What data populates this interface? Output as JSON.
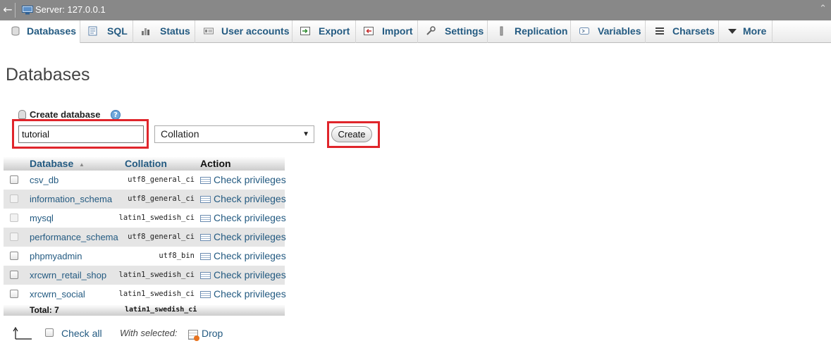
{
  "serverbar": {
    "label": "Server: 127.0.0.1",
    "back_glyph": "←",
    "collapse_glyph": "⌃"
  },
  "tabs": [
    {
      "label": "Databases",
      "icon": "database-icon",
      "active": true
    },
    {
      "label": "SQL",
      "icon": "sql-icon"
    },
    {
      "label": "Status",
      "icon": "status-icon"
    },
    {
      "label": "User accounts",
      "icon": "user-accounts-icon"
    },
    {
      "label": "Export",
      "icon": "export-icon"
    },
    {
      "label": "Import",
      "icon": "import-icon"
    },
    {
      "label": "Settings",
      "icon": "wrench-icon"
    },
    {
      "label": "Replication",
      "icon": "replication-icon"
    },
    {
      "label": "Variables",
      "icon": "variables-icon"
    },
    {
      "label": "Charsets",
      "icon": "charsets-icon"
    },
    {
      "label": "More",
      "icon": "caret-down-icon"
    }
  ],
  "page_title": "Databases",
  "create": {
    "heading": "Create database",
    "help_glyph": "?",
    "name_value": "tutorial",
    "collation_selected": "Collation",
    "collation_caret": "▼",
    "button_label": "Create",
    "highlight_color": "#e0252b"
  },
  "table": {
    "headers": {
      "database": "Database",
      "sort_glyph": "▲",
      "collation": "Collation",
      "action": "Action"
    },
    "rows": [
      {
        "name": "csv_db",
        "collation": "utf8_general_ci",
        "action": "Check privileges",
        "system": false
      },
      {
        "name": "information_schema",
        "collation": "utf8_general_ci",
        "action": "Check privileges",
        "system": true
      },
      {
        "name": "mysql",
        "collation": "latin1_swedish_ci",
        "action": "Check privileges",
        "system": true
      },
      {
        "name": "performance_schema",
        "collation": "utf8_general_ci",
        "action": "Check privileges",
        "system": true
      },
      {
        "name": "phpmyadmin",
        "collation": "utf8_bin",
        "action": "Check privileges",
        "system": false
      },
      {
        "name": "xrcwrn_retail_shop",
        "collation": "latin1_swedish_ci",
        "action": "Check privileges",
        "system": false
      },
      {
        "name": "xrcwrn_social",
        "collation": "latin1_swedish_ci",
        "action": "Check privileges",
        "system": false
      }
    ],
    "total_label": "Total: 7",
    "total_collation": "latin1_swedish_ci"
  },
  "footer": {
    "check_all": "Check all",
    "with_selected": "With selected:",
    "drop": "Drop"
  },
  "colors": {
    "link": "#235a81",
    "serverbar": "#888888",
    "row_alt": "#e5e5e5"
  }
}
